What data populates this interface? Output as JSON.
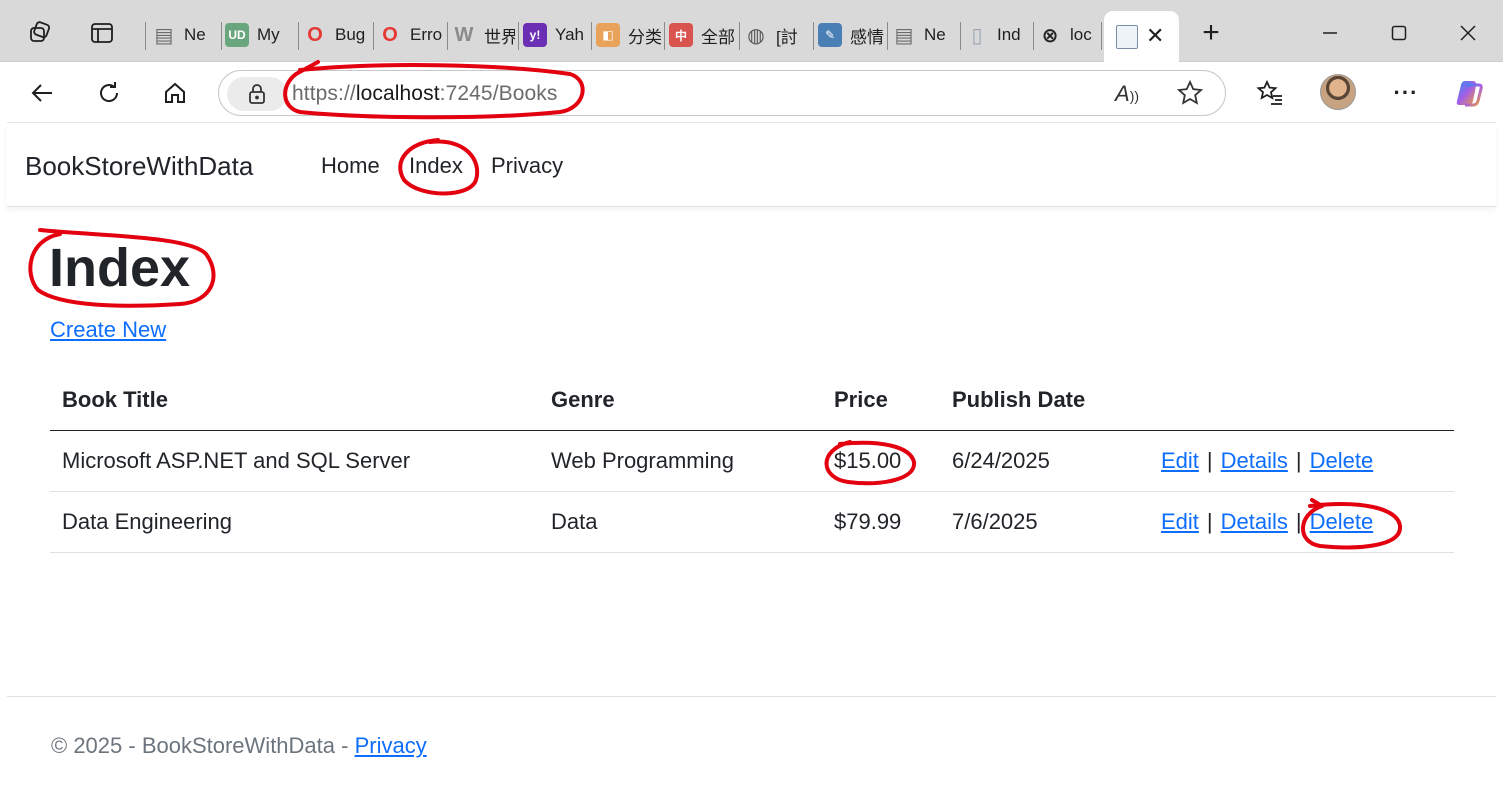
{
  "browser": {
    "tabs": [
      {
        "title": "Ne",
        "icon": "page-icon",
        "color": "#6b6b6b"
      },
      {
        "title": "My",
        "icon": "und-icon",
        "color": "#6aa67d"
      },
      {
        "title": "Bug",
        "icon": "opera-icon",
        "color": "#e53935"
      },
      {
        "title": "Erro",
        "icon": "opera-icon",
        "color": "#e53935"
      },
      {
        "title": "世界",
        "icon": "w-icon",
        "color": "#8a8a8a"
      },
      {
        "title": "Yah",
        "icon": "yahoo-icon",
        "color": "#6b2fb3"
      },
      {
        "title": "分类",
        "icon": "plug-icon",
        "color": "#e8a25a"
      },
      {
        "title": "全部",
        "icon": "zhong-icon",
        "color": "#d9534f"
      },
      {
        "title": "[討",
        "icon": "globe-icon",
        "color": "#555555"
      },
      {
        "title": "感情",
        "icon": "edit-doc-icon",
        "color": "#4a7fb5"
      },
      {
        "title": "Ne",
        "icon": "page-icon",
        "color": "#6b6b6b"
      },
      {
        "title": "Ind",
        "icon": "doc-icon",
        "color": "#9aa5b1"
      },
      {
        "title": "loc",
        "icon": "error-doc-icon",
        "color": "#222222"
      }
    ],
    "url": {
      "scheme": "https://",
      "host": "localhost",
      "rest": ":7245/Books"
    }
  },
  "site": {
    "brand": "BookStoreWithData",
    "nav": [
      "Home",
      "Index",
      "Privacy"
    ]
  },
  "page": {
    "title": "Index",
    "create_link": "Create New"
  },
  "table": {
    "headers": [
      "Book Title",
      "Genre",
      "Price",
      "Publish Date"
    ],
    "rows": [
      {
        "title": "Microsoft ASP.NET and SQL Server",
        "genre": "Web Programming",
        "price": "$15.00",
        "date": "6/24/2025"
      },
      {
        "title": "Data Engineering",
        "genre": "Data",
        "price": "$79.99",
        "date": "7/6/2025"
      }
    ],
    "actions": {
      "edit": "Edit",
      "details": "Details",
      "delete": "Delete",
      "sep": "|"
    }
  },
  "footer": {
    "text": "© 2025 - BookStoreWithData - ",
    "link": "Privacy"
  },
  "colors": {
    "link": "#0d6efd",
    "annotation": "#e3000f"
  }
}
